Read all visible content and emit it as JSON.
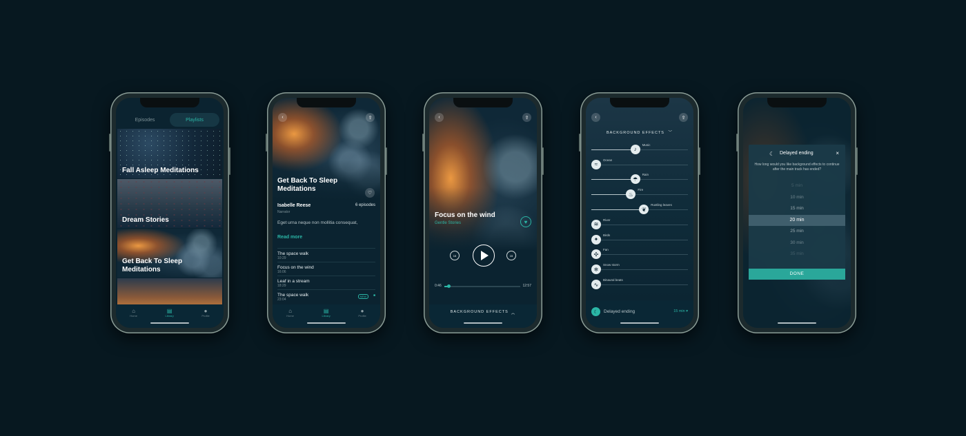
{
  "colors": {
    "background": "#071820",
    "accent": "#2bb6a6",
    "screen": "#0d2530"
  },
  "tabbar": {
    "home": "Home",
    "library": "Library",
    "profile": "Profile"
  },
  "phone1": {
    "segments": [
      "Episodes",
      "Playlists"
    ],
    "cards": [
      "Fall Asleep Meditations",
      "Dream Stories",
      "Get Back To Sleep Meditations"
    ]
  },
  "phone2": {
    "title": "Get Back To Sleep Meditations",
    "narrator_name": "Isabelle Reese",
    "narrator_role": "Narrator",
    "episodes_count": "6 episodes",
    "description": "Eget urna neque non mollitia consequat,",
    "read_more": "Read more",
    "tracks": [
      {
        "title": "The space walk",
        "duration": "10:29",
        "badge": ""
      },
      {
        "title": "Focus on the wind",
        "duration": "16:06",
        "badge": ""
      },
      {
        "title": "Leaf in a stream",
        "duration": "18:29",
        "badge": ""
      },
      {
        "title": "The space walk",
        "duration": "23:04",
        "badge": "NEW"
      }
    ]
  },
  "phone3": {
    "title": "Focus on the wind",
    "subtitle": "Gentle Stories",
    "time_elapsed": "0:46",
    "time_total": "12:57",
    "progress": 0.06,
    "bottom_label": "BACKGROUND EFFECTS"
  },
  "phone4": {
    "header": "BACKGROUND EFFECTS",
    "effects": [
      {
        "name": "Music",
        "icon": "music-icon",
        "glyph": "♪",
        "level": 0.45
      },
      {
        "name": "Ocean",
        "icon": "wave-icon",
        "glyph": "≈",
        "level": 0
      },
      {
        "name": "Rain",
        "icon": "rain-icon",
        "glyph": "☂",
        "level": 0.45
      },
      {
        "name": "Fire",
        "icon": "fire-icon",
        "glyph": "♨",
        "level": 0.4
      },
      {
        "name": "Rustling leaves",
        "icon": "leaf-icon",
        "glyph": "❦",
        "level": 0.55
      },
      {
        "name": "River",
        "icon": "river-icon",
        "glyph": "≋",
        "level": 0
      },
      {
        "name": "Birds",
        "icon": "bird-icon",
        "glyph": "✦",
        "level": 0
      },
      {
        "name": "Fan",
        "icon": "fan-icon",
        "glyph": "✣",
        "level": 0
      },
      {
        "name": "Snow storm",
        "icon": "snowflake-icon",
        "glyph": "❄",
        "level": 0
      },
      {
        "name": "Binaural beats",
        "icon": "waveform-icon",
        "glyph": "∿",
        "level": 0
      }
    ],
    "delayed_label": "Delayed ending",
    "delayed_value": "15 min"
  },
  "phone5": {
    "title": "Delayed ending",
    "question": "How long would you like background effects to continue after the main track has ended?",
    "options": [
      "5 min",
      "10 min",
      "15 min",
      "20 min",
      "25 min",
      "30 min",
      "35 min"
    ],
    "selected": "20 min",
    "done": "DONE"
  }
}
